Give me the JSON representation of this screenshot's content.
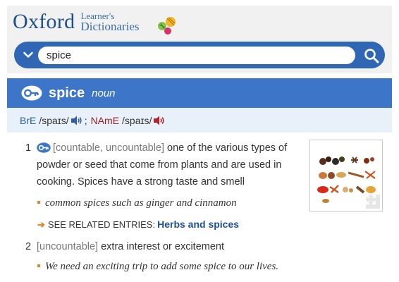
{
  "header": {
    "brand": "Oxford",
    "brand_sub_line1": "Learner's",
    "brand_sub_line2": "Dictionaries",
    "brand_color": "#1e4f8a"
  },
  "search": {
    "value": "spice",
    "dropdown_icon": "chevron-down-icon",
    "search_icon": "search-icon",
    "bar_color": "#2f67b4"
  },
  "entry": {
    "headword": "spice",
    "pos": "noun",
    "key_icon": "key-icon",
    "head_color": "#3d76c8",
    "pron": {
      "br_label": "BrE",
      "br_ipa": "/spaɪs/",
      "separator": ";",
      "am_label": "NAmE",
      "am_ipa": "/spaɪs/"
    }
  },
  "senses": [
    {
      "num": "1",
      "grammar": "[countable, uncountable]",
      "definition_line1": "one of the various types of",
      "definition_line2": "powder or seed that come from plants and are used in",
      "definition_line3": "cooking. Spices have a strong taste and smell",
      "example": "common spices such as ginger and cinnamon",
      "related_label": "SEE RELATED ENTRIES:",
      "related_link": "Herbs and spices"
    },
    {
      "num": "2",
      "grammar": "[uncountable]",
      "definition": "extra interest or excitement",
      "example": "We need an exciting trip to add some spice to our lives."
    }
  ],
  "thumbnail": {
    "expand_icon": "expand-icon"
  }
}
